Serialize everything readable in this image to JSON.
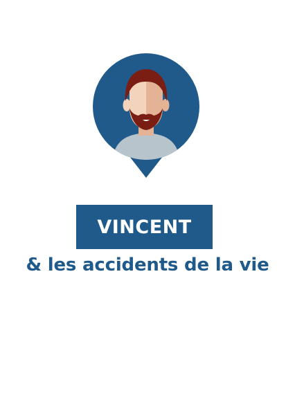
{
  "colors": {
    "accent": "#1f5a8b",
    "background": "#ffffff",
    "skin": "#f3d3bb",
    "skin_shadow": "#e4b396",
    "hair": "#7a1d12",
    "shirt": "#b8c4cc"
  },
  "avatar": {
    "icon": "bearded-man-avatar-icon"
  },
  "title": {
    "name": "VINCENT",
    "subtitle": "& les accidents de la vie"
  }
}
